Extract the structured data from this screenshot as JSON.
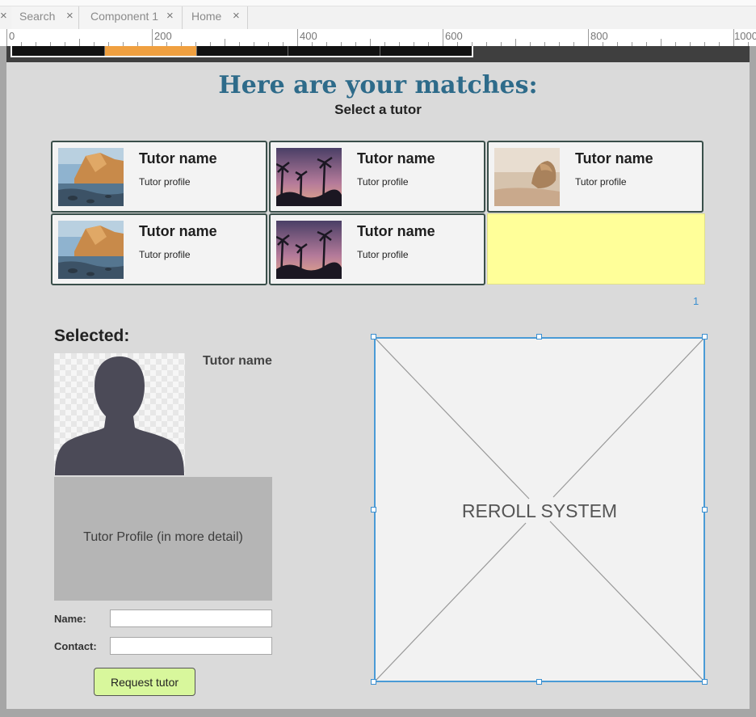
{
  "tabs": [
    {
      "label": "Search"
    },
    {
      "label": "Component 1"
    },
    {
      "label": "Home"
    }
  ],
  "ruler": {
    "labels": [
      "0",
      "200",
      "400",
      "600",
      "800",
      "1000"
    ]
  },
  "wizard_progress": {
    "active_step": 2,
    "total_steps": 5,
    "fill_color": "#f0a040"
  },
  "page": {
    "title": "Here are your matches:",
    "subtitle": "Select a tutor"
  },
  "tutors": [
    {
      "name": "Tutor name",
      "profile": "Tutor profile",
      "image": "coastal-cliffs-photo"
    },
    {
      "name": "Tutor name",
      "profile": "Tutor profile",
      "image": "palm-sunset-photo"
    },
    {
      "name": "Tutor name",
      "profile": "Tutor profile",
      "image": "beach-rock-photo"
    },
    {
      "name": "Tutor name",
      "profile": "Tutor profile",
      "image": "coastal-cliffs-photo"
    },
    {
      "name": "Tutor name",
      "profile": "Tutor profile",
      "image": "palm-sunset-photo"
    }
  ],
  "pagination": {
    "current": "1"
  },
  "selected": {
    "heading": "Selected:",
    "tutor_name": "Tutor name",
    "detail_text": "Tutor Profile (in more detail)",
    "avatar_icon": "person-silhouette-icon"
  },
  "form": {
    "name_label": "Name:",
    "name_value": "",
    "contact_label": "Contact:",
    "contact_value": "",
    "request_label": "Request tutor"
  },
  "reroll": {
    "label": "REROLL SYSTEM"
  },
  "colors": {
    "title": "#2e6b8a",
    "selection": "#4a9bd6",
    "button": "#d8f79c",
    "highlight": "#ffff99"
  }
}
